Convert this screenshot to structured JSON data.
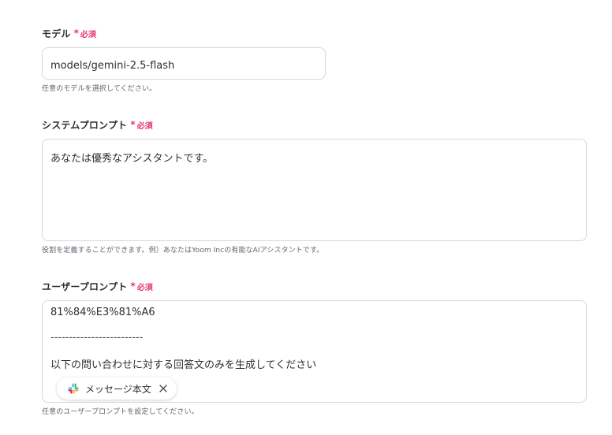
{
  "model_field": {
    "label": "モデル",
    "required": "必須",
    "value": "models/gemini-2.5-flash",
    "help": "任意のモデルを選択してください。"
  },
  "system_prompt_field": {
    "label": "システムプロンプト",
    "required": "必須",
    "value": "あなたは優秀なアシスタントです。",
    "help": "役割を定義することができます。例）あなたはYoom Incの有能なAIアシスタントです。"
  },
  "user_prompt_field": {
    "label": "ユーザープロンプト",
    "required": "必須",
    "lines": [
      "81%84%E3%81%A6",
      "-------------------------",
      "以下の問い合わせに対する回答文のみを生成してください"
    ],
    "chip": {
      "icon": "slack-icon",
      "label": "メッセージ本文"
    },
    "help": "任意のユーザープロンプトを設定してください。"
  },
  "colors": {
    "required": "#e5356f",
    "border": "#d4d8dd"
  }
}
